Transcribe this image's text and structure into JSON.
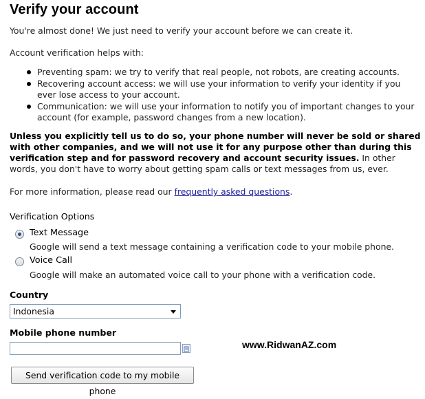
{
  "header": {
    "title": "Verify your account"
  },
  "intro": "You're almost done! We just need to verify your account before we can create it.",
  "helps_heading": "Account verification helps with:",
  "bullets": [
    "Preventing spam: we try to verify that real people, not robots, are creating accounts.",
    "Recovering account access: we will use your information to verify your identity if you ever lose access to your account.",
    "Communication: we will use your information to notify you of important changes to your account (for example, password changes from a new location)."
  ],
  "privacy": {
    "bold": "Unless you explicitly tell us to do so, your phone number will never be sold or shared with other companies, and we will not use it for any purpose other than during this verification step and for password recovery and account security issues.",
    "normal": " In other words, you don't have to worry about getting spam calls or text messages from us, ever."
  },
  "more_info": {
    "prefix": "For more information, please read our ",
    "link": "frequently asked questions",
    "suffix": "."
  },
  "verification": {
    "heading": "Verification Options",
    "options": [
      {
        "label": "Text Message",
        "desc": "Google will send a text message containing a verification code to your mobile phone.",
        "checked": true
      },
      {
        "label": "Voice Call",
        "desc": "Google will make an automated voice call to your phone with a verification code.",
        "checked": false
      }
    ]
  },
  "country": {
    "label": "Country",
    "selected": "Indonesia"
  },
  "phone": {
    "label": "Mobile phone number",
    "value": ""
  },
  "submit_label": "Send verification code to my mobile phone",
  "watermark": "www.RidwanAZ.com"
}
